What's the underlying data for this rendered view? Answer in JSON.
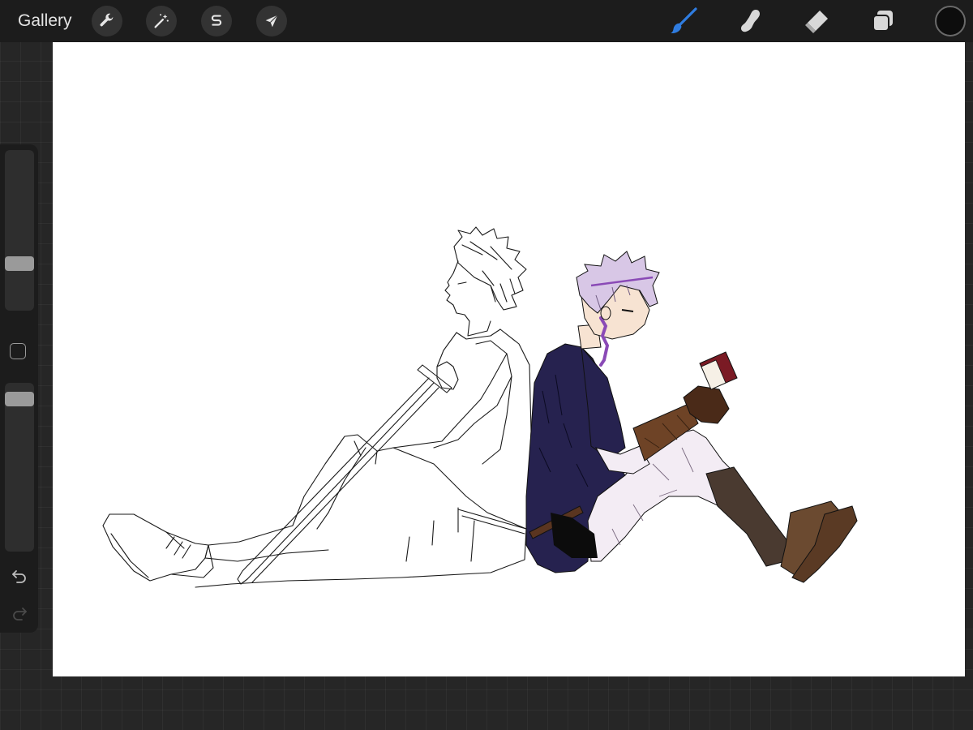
{
  "topbar": {
    "gallery_label": "Gallery",
    "actions_icon": "wrench-icon",
    "adjustments_icon": "magic-wand-icon",
    "selection_icon": "selection-s-icon",
    "transform_icon": "arrow-cursor-icon",
    "tools": [
      {
        "name": "brush",
        "icon": "brush-icon",
        "active": true
      },
      {
        "name": "smudge",
        "icon": "smudge-finger-icon",
        "active": false
      },
      {
        "name": "eraser",
        "icon": "eraser-icon",
        "active": false
      },
      {
        "name": "layers",
        "icon": "layers-icon",
        "active": false
      }
    ],
    "current_color": "#0d0d0d"
  },
  "sidebar": {
    "brush_size_level": 0.27,
    "opacity_level": 0.94,
    "undo_icon": "undo-icon",
    "redo_icon": "redo-icon"
  },
  "colors": {
    "accent_active_tool": "#2f7ce0",
    "tunic": "#26224f",
    "trousers": "#f3ecf4",
    "hair": "#d8c7e6",
    "boots": "#4a3a30",
    "bracer": "#6e4326",
    "book": "#7a1a24"
  }
}
